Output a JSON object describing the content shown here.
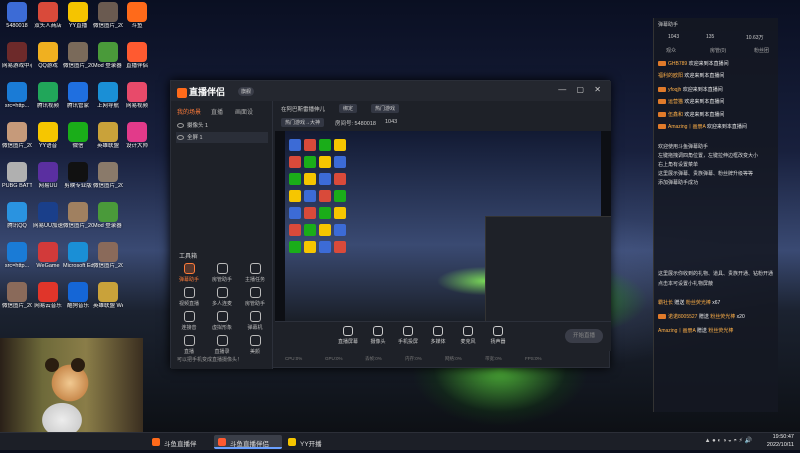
{
  "desktop_icons": [
    {
      "label": "5480018",
      "color": "#3c6bd6"
    },
    {
      "label": "网易游戏中心",
      "color": "#6d2a2a"
    },
    {
      "label": "src=http...",
      "color": "#1a7bd6"
    },
    {
      "label": "微信图片_2022101...",
      "color": "#c69a7a"
    },
    {
      "label": "PUBG BATTLEGR...",
      "color": "#b0b0b0"
    },
    {
      "label": "腾讯QQ",
      "color": "#2a93e0"
    },
    {
      "label": "src=http...",
      "color": "#1a7bd6"
    },
    {
      "label": "微信图片_2022101...",
      "color": "#8a6a5a"
    },
    {
      "label": "双头人商店",
      "color": "#d94a3a"
    },
    {
      "label": "QQ游戏",
      "color": "#f0b020"
    },
    {
      "label": "腾讯视频",
      "color": "#21a65a"
    },
    {
      "label": "YY语音",
      "color": "#f6c600"
    },
    {
      "label": "网易UU",
      "color": "#5a2fa0"
    },
    {
      "label": "网易UU加速器",
      "color": "#1a3f8a"
    },
    {
      "label": "WeGame",
      "color": "#d23a3a"
    },
    {
      "label": "网易云音乐",
      "color": "#e0352a"
    },
    {
      "label": "YY直播",
      "color": "#f5c400"
    },
    {
      "label": "微信图片_2022101...",
      "color": "#7a6a5a"
    },
    {
      "label": "腾讯管家",
      "color": "#1f6fe0"
    },
    {
      "label": "微信",
      "color": "#1aad19"
    },
    {
      "label": "剪映专业版",
      "color": "#111111"
    },
    {
      "label": "微信图片_2022101...",
      "color": "#a08060"
    },
    {
      "label": "Microsoft Edge",
      "color": "#1a8fd6"
    },
    {
      "label": "酷狗音乐",
      "color": "#1566d6"
    },
    {
      "label": "微信图片_2022101...",
      "color": "#6a5a50"
    },
    {
      "label": "Mod 登录器 1.43",
      "color": "#4a9a3a"
    },
    {
      "label": "上网导航",
      "color": "#1a8fd6"
    },
    {
      "label": "英雄联盟",
      "color": "#c9a23a"
    },
    {
      "label": "微信图片_2022101...",
      "color": "#8a7a6a"
    },
    {
      "label": "Mod 登录器 1.17",
      "color": "#4a9a3a"
    },
    {
      "label": "微信图片_2022101...",
      "color": "#8a6a5a"
    },
    {
      "label": "英雄联盟 WeGame版",
      "color": "#c9a23a"
    },
    {
      "label": "斗鱼",
      "color": "#ff6a1a"
    },
    {
      "label": "直播伴侣",
      "color": "#ff5a30"
    },
    {
      "label": "网易视频",
      "color": "#e84a6a"
    },
    {
      "label": "设计大师",
      "color": "#e23a8a"
    }
  ],
  "obs": {
    "logo": "直播伴侣",
    "version": "旗舰",
    "window_controls": "— ▢ ✕",
    "tabs": [
      "我的场景",
      "直播",
      "画面设"
    ],
    "scenes": [
      "摄像头 1",
      "全屏 1"
    ],
    "tools_title": "工具箱",
    "tools": [
      "弹幕助手",
      "房管助手",
      "主播任务",
      "视频直播",
      "多人连麦",
      "房管助手",
      "连接音",
      "虚拟形象",
      "弹幕机",
      "直播",
      "直播录",
      "美颜"
    ],
    "footer_link": "可以把手机变成直播摄像头！",
    "preview_title": "在阿巴斯雷播伸儿",
    "chip1": "绑定",
    "chip2": "热门游戏",
    "chip3": "热门游戏→大神",
    "room": "房间号: 5480018",
    "viewers": "1043",
    "bottom_buttons": [
      "直播屏幕",
      "摄像头",
      "手机投屏",
      "多媒体",
      "麦克风",
      "扬声器"
    ],
    "go_live": "开始直播",
    "status": [
      "CPU:0%",
      "GPU:0%",
      "丢帧:0%",
      "内存:0%",
      "网络:0%",
      "带宽:0%",
      "FPS:0%"
    ]
  },
  "assistant": {
    "title": "弹幕助手",
    "stats": [
      "1043",
      "135",
      "10.63万"
    ],
    "tabs": [
      "观众",
      "房管(0)",
      "粉丝团"
    ],
    "messages": [
      {
        "name": "GHB789",
        "text": "欢迎来到本直播间"
      },
      {
        "name": "福利的欧阳",
        "text": "欢迎来到本直播间"
      },
      {
        "name": "yfoqjh",
        "text": "欢迎来到本直播间"
      },
      {
        "name": "运营猫",
        "text": "欢迎来到本直播间"
      },
      {
        "name": "伍鑫和",
        "text": "欢迎来到本直播间"
      },
      {
        "name": "Amazing丨画册A",
        "text": "欢迎来到本直播间"
      }
    ],
    "notes": [
      "欢迎使用斗鱼弹幕助手",
      "左键拖拽调四角位置，左键拉伸边框改变大小",
      "右上角有设置菜单",
      "这里展示弹幕、贵族弹幕、粉丝牌升级等等",
      "添加弹幕助手成功",
      "",
      "这里展示你收到的礼物、道具、贵族开通、钻粉开通",
      "点击本可设置小礼物屏蔽"
    ],
    "gifts": [
      {
        "name": "霸社长",
        "action": "赠送",
        "item": "粉丝荧光棒",
        "count": "x67"
      },
      {
        "name": "诺诺8005527",
        "action": "赠送",
        "item": "粉丝荧光棒",
        "count": "x20"
      },
      {
        "name": "Amazing丨画册A",
        "action": "赠送",
        "item": "粉丝荧光棒",
        "count": ""
      }
    ]
  },
  "taskbar": {
    "apps": [
      "斗鱼直播伴",
      "斗鱼直播伴侣",
      "YY开播"
    ],
    "time": "19:50:47",
    "date": "2022/10/11"
  }
}
